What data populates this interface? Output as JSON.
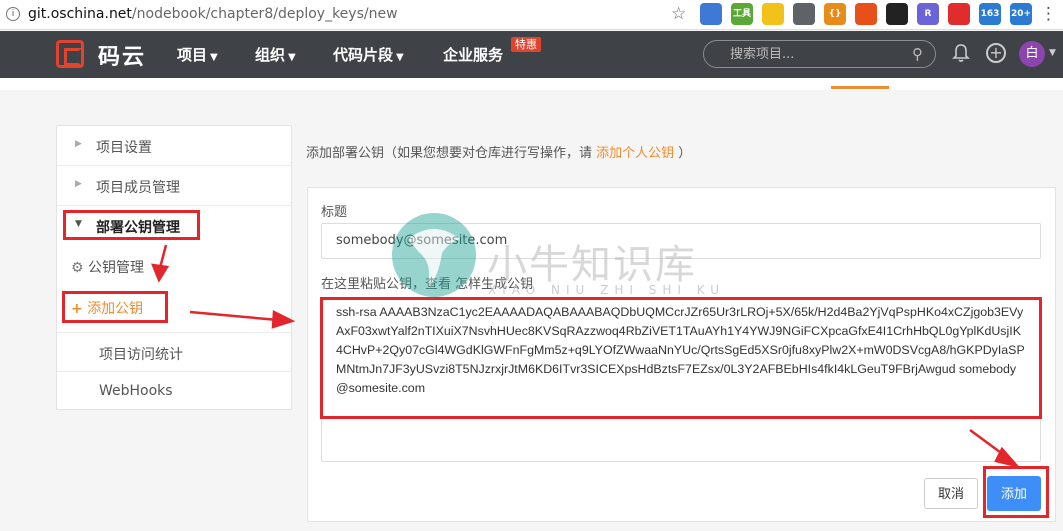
{
  "browser": {
    "url_domain": "git.oschina.net",
    "url_path": "/nodebook/chapter8/deploy_keys/new",
    "extensions": [
      {
        "name": "ext-blue-icon",
        "text": "",
        "color": "#3e79d6"
      },
      {
        "name": "ext-tools-icon",
        "text": "工具",
        "color": "#5aa835"
      },
      {
        "name": "ext-yellow-icon",
        "text": "",
        "color": "#f2c21b"
      },
      {
        "name": "ext-chrome-icon",
        "text": "",
        "color": "#5f6368"
      },
      {
        "name": "ext-braces-icon",
        "text": "{}",
        "color": "#e88b1a"
      },
      {
        "name": "ext-orange-ring-icon",
        "text": "",
        "color": "#e8501a"
      },
      {
        "name": "ext-black-icon",
        "text": "",
        "color": "#222222"
      },
      {
        "name": "ext-purple-icon",
        "text": "R",
        "color": "#6b63d8"
      },
      {
        "name": "ext-red-icon",
        "text": "",
        "color": "#e02c2c"
      },
      {
        "name": "ext-163-icon",
        "text": "163",
        "color": "#2b7bd3"
      },
      {
        "name": "ext-20plus-icon",
        "text": "20+",
        "color": "#2b7bd3"
      }
    ]
  },
  "nav": {
    "logo": "码云",
    "items": [
      "项目",
      "组织",
      "代码片段",
      "企业服务"
    ],
    "badge": "特惠",
    "search_placeholder": "搜索项目...",
    "avatar": "白"
  },
  "sidebar": {
    "items": [
      "项目设置",
      "项目成员管理",
      "部署公钥管理"
    ],
    "sub_manage": "公钥管理",
    "sub_add": "添加公钥",
    "items_after": [
      "项目访问统计",
      "WebHooks"
    ]
  },
  "main": {
    "title_prefix": "添加部署公钥（如果您想要对仓库进行写操作，请 ",
    "title_link": "添加个人公钥",
    "title_suffix": " ）",
    "title_label": "标题",
    "title_value": "somebody@somesite.com",
    "key_label_prefix": "在这里粘贴公钥，",
    "key_label_link": "查看 怎样生成公钥",
    "key_value": "ssh-rsa AAAAB3NzaC1yc2EAAAADAQABAAABAQDbUQMCcrJZr65Ur3rLROj+5X/65k/H2d4Ba2YjVqPspHKo4xCZjgob3EVyAxF03xwtYalf2nTIXuiX7NsvhHUec8KVSqRAzzwoq4RbZiVET1TAuAYh1Y4YWJ9NGiFCXpcaGfxE4I1CrhHbQL0gYplKdUsjIK4CHvP+2Qy07cGl4WGdKlGWFnFgMm5z+q9LYOfZWwaaNnYUc/QrtsSgEd5XSr0jfu8xyPlw2X+mW0DSVcgA8/hGKPDyIaSPMNtmJn7JF3yUSvzi8T5NJzrxjrJtM6KD6ITvr3SICEXpsHdBztsF7EZsx/0L3Y2AFBEbHIs4fkI4kLGeuT9FBrjAwgud somebody@somesite.com",
    "cancel_label": "取消",
    "add_label": "添加"
  },
  "watermark": {
    "text": "小牛知识库",
    "sub": "XIAO NIU ZHI SHI KU"
  }
}
